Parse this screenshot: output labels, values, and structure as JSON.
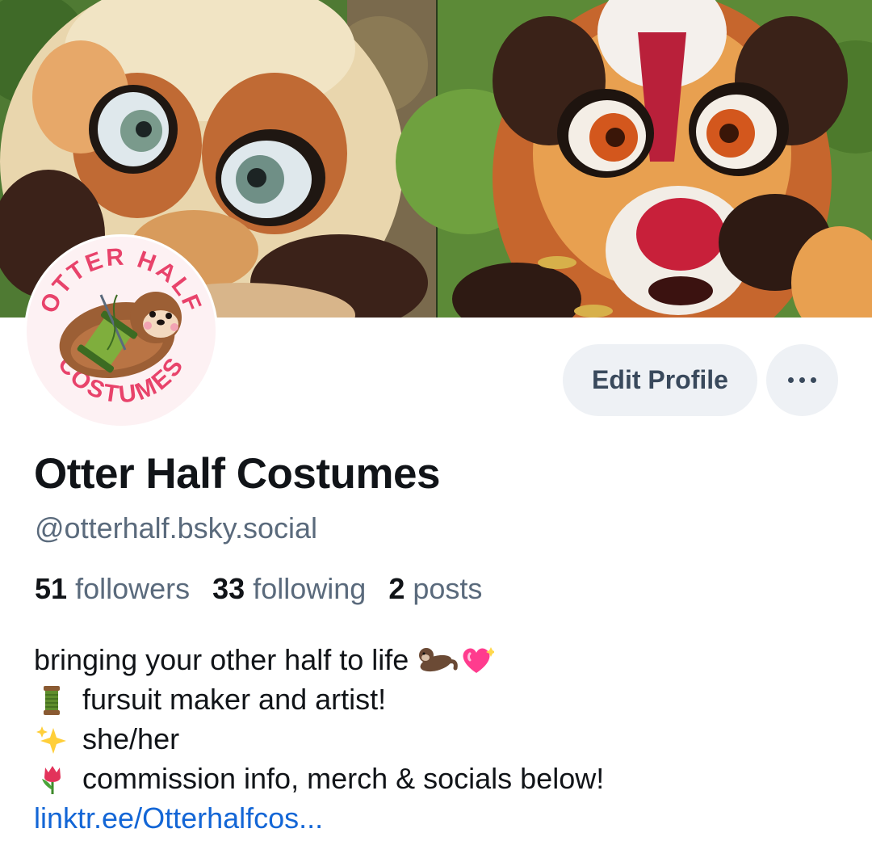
{
  "profile": {
    "display_name": "Otter Half Costumes",
    "handle": "@otterhalf.bsky.social",
    "edit_label": "Edit Profile",
    "avatar": {
      "logo_top_text": "OTTER HALF",
      "logo_bottom_text": "COSTUMES"
    }
  },
  "stats": {
    "followers_count": "51",
    "followers_label": "followers",
    "following_count": "33",
    "following_label": "following",
    "posts_count": "2",
    "posts_label": "posts"
  },
  "bio": {
    "line1": "bringing your other half to life",
    "line1_icons": [
      "otter-emoji",
      "sparkling-heart-emoji"
    ],
    "line2": "fursuit maker and artist!",
    "line2_icon": "thread-spool-emoji",
    "line3": "she/her",
    "line3_icon": "sparkles-emoji",
    "line4": "commission info, merch & socials below!",
    "line4_icon": "tulip-emoji",
    "link": "linktr.ee/Otterhalfcos..."
  },
  "colors": {
    "link": "#1366d6",
    "button_bg": "#eef1f5",
    "secondary_text": "#5a6a7c",
    "logo_pink": "#e8436b"
  }
}
